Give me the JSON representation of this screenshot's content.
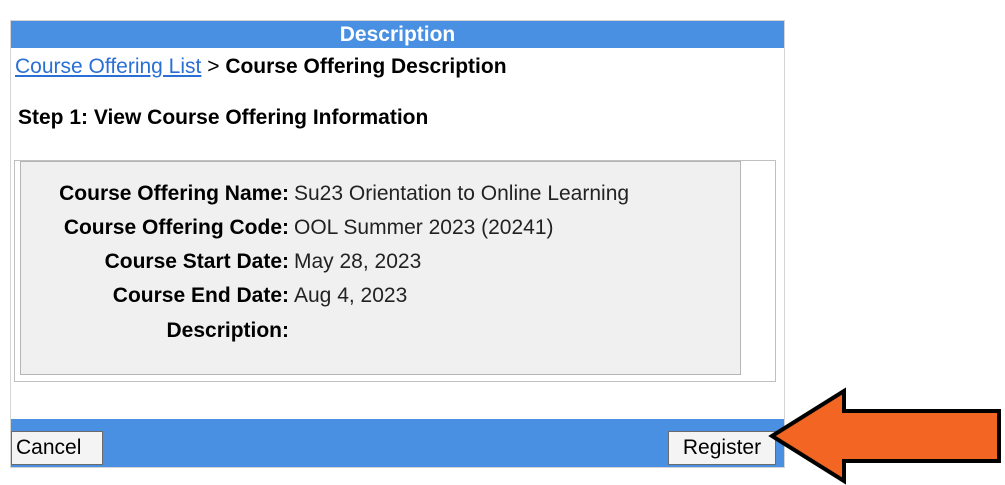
{
  "dialog": {
    "title": "Description"
  },
  "breadcrumb": {
    "link_label": "Course Offering List",
    "separator": " > ",
    "current_label": "Course Offering Description"
  },
  "step": {
    "heading": "Step 1: View Course Offering Information"
  },
  "course_info": {
    "fields": [
      {
        "label": "Course Offering Name:",
        "value": "Su23 Orientation to Online Learning"
      },
      {
        "label": "Course Offering Code:",
        "value": "OOL Summer 2023 (20241)"
      },
      {
        "label": "Course Start Date:",
        "value": "May 28, 2023"
      },
      {
        "label": "Course End Date:",
        "value": "Aug 4, 2023"
      },
      {
        "label": "Description:",
        "value": ""
      }
    ]
  },
  "actions": {
    "cancel_label": "Cancel",
    "register_label": "Register"
  },
  "colors": {
    "bar_blue": "#4a90e2",
    "arrow_orange": "#f26522",
    "panel_gray": "#f0f0f0"
  },
  "icons": {
    "annotation": "left-arrow-icon"
  }
}
